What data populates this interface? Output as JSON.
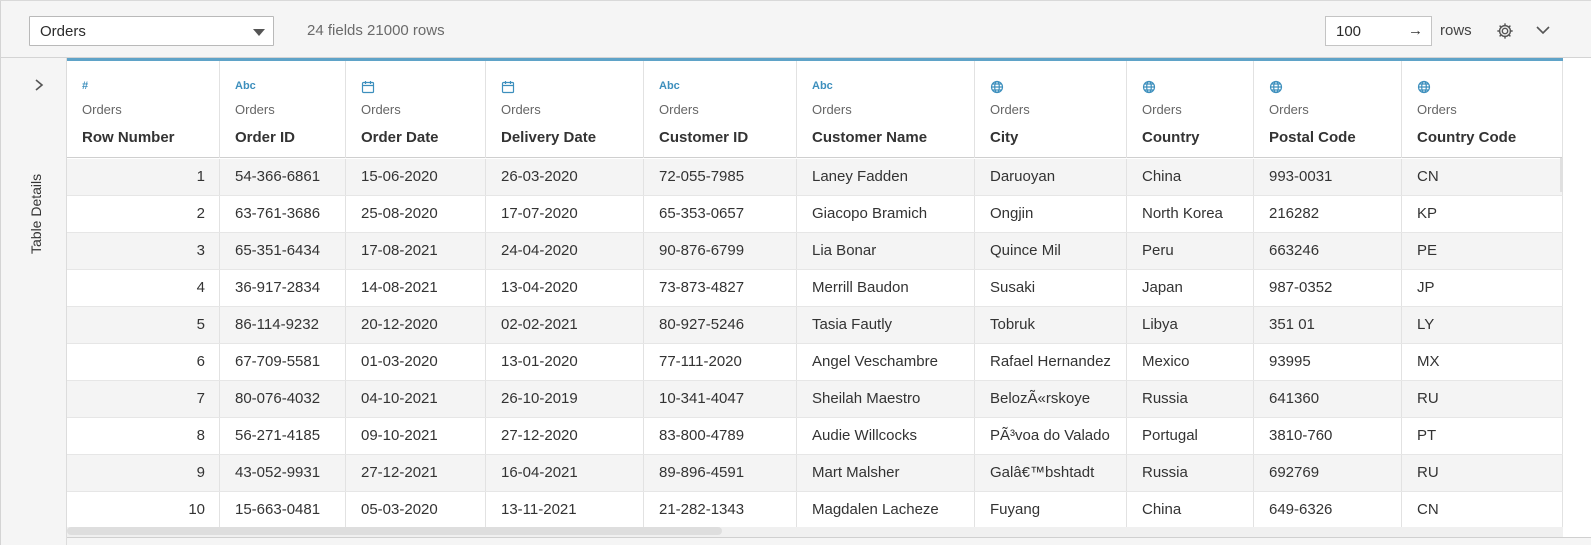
{
  "toolbar": {
    "table_select": "Orders",
    "summary": "24 fields 21000 rows",
    "rows_value": "100",
    "rows_arrow": "→",
    "rows_label": "rows"
  },
  "side_panel": {
    "expand_glyph": "›",
    "label": "Table Details"
  },
  "columns": [
    {
      "type_icon": "number-icon",
      "type_text": "#",
      "source": "Orders",
      "name": "Row Number"
    },
    {
      "type_icon": "string-icon",
      "type_text": "Abc",
      "source": "Orders",
      "name": "Order ID"
    },
    {
      "type_icon": "calendar-icon",
      "type_text": "",
      "source": "Orders",
      "name": "Order Date"
    },
    {
      "type_icon": "calendar-icon",
      "type_text": "",
      "source": "Orders",
      "name": "Delivery Date"
    },
    {
      "type_icon": "string-icon",
      "type_text": "Abc",
      "source": "Orders",
      "name": "Customer ID"
    },
    {
      "type_icon": "string-icon",
      "type_text": "Abc",
      "source": "Orders",
      "name": "Customer Name"
    },
    {
      "type_icon": "globe-icon",
      "type_text": "",
      "source": "Orders",
      "name": "City"
    },
    {
      "type_icon": "globe-icon",
      "type_text": "",
      "source": "Orders",
      "name": "Country"
    },
    {
      "type_icon": "globe-icon",
      "type_text": "",
      "source": "Orders",
      "name": "Postal Code"
    },
    {
      "type_icon": "globe-icon",
      "type_text": "",
      "source": "Orders",
      "name": "Country Code"
    }
  ],
  "rows": [
    [
      "1",
      "54-366-6861",
      "15-06-2020",
      "26-03-2020",
      "72-055-7985",
      "Laney Fadden",
      "Daruoyan",
      "China",
      "993-0031",
      "CN"
    ],
    [
      "2",
      "63-761-3686",
      "25-08-2020",
      "17-07-2020",
      "65-353-0657",
      "Giacopo Bramich",
      "Ongjin",
      "North Korea",
      "216282",
      "KP"
    ],
    [
      "3",
      "65-351-6434",
      "17-08-2021",
      "24-04-2020",
      "90-876-6799",
      "Lia Bonar",
      "Quince Mil",
      "Peru",
      "663246",
      "PE"
    ],
    [
      "4",
      "36-917-2834",
      "14-08-2021",
      "13-04-2020",
      "73-873-4827",
      "Merrill Baudon",
      "Susaki",
      "Japan",
      "987-0352",
      "JP"
    ],
    [
      "5",
      "86-114-9232",
      "20-12-2020",
      "02-02-2021",
      "80-927-5246",
      "Tasia Fautly",
      "Tobruk",
      "Libya",
      "351 01",
      "LY"
    ],
    [
      "6",
      "67-709-5581",
      "01-03-2020",
      "13-01-2020",
      "77-111-2020",
      "Angel Veschambre",
      "Rafael Hernandez",
      "Mexico",
      "93995",
      "MX"
    ],
    [
      "7",
      "80-076-4032",
      "04-10-2021",
      "26-10-2019",
      "10-341-4047",
      "Sheilah Maestro",
      "BelozÃ«rskoye",
      "Russia",
      "641360",
      "RU"
    ],
    [
      "8",
      "56-271-4185",
      "09-10-2021",
      "27-12-2020",
      "83-800-4789",
      "Audie Willcocks",
      "PÃ³voa do Valado",
      "Portugal",
      "3810-760",
      "PT"
    ],
    [
      "9",
      "43-052-9931",
      "27-12-2021",
      "16-04-2021",
      "89-896-4591",
      "Mart Malsher",
      "Galâ€™bshtadt",
      "Russia",
      "692769",
      "RU"
    ],
    [
      "10",
      "15-663-0481",
      "05-03-2020",
      "13-11-2021",
      "21-282-1343",
      "Magdalen Lacheze",
      "Fuyang",
      "China",
      "649-6326",
      "CN"
    ]
  ],
  "colors": {
    "accent": "#3d8fbd",
    "header_rule": "#5fa3c8",
    "row_stripe": "#f4f4f4",
    "toolbar_bg": "#f5f5f5"
  }
}
